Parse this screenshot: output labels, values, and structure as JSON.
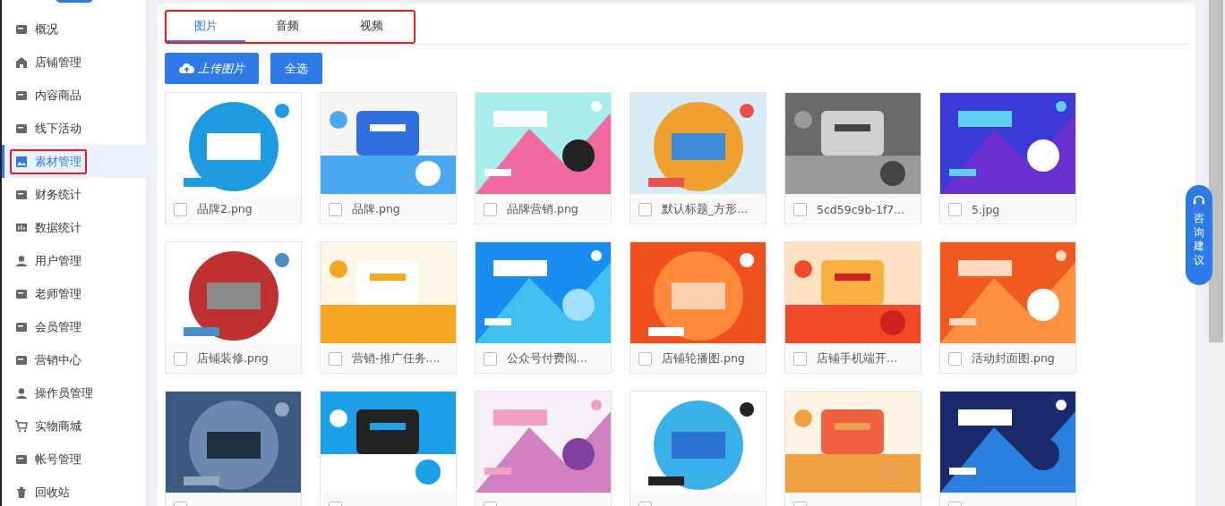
{
  "sidebar": {
    "items": [
      {
        "label": "概况",
        "selected": false,
        "highlighted": false
      },
      {
        "label": "店铺管理",
        "selected": false,
        "highlighted": false
      },
      {
        "label": "内容商品",
        "selected": false,
        "highlighted": false
      },
      {
        "label": "线下活动",
        "selected": false,
        "highlighted": false
      },
      {
        "label": "素材管理",
        "selected": true,
        "highlighted": true
      },
      {
        "label": "财务统计",
        "selected": false,
        "highlighted": false
      },
      {
        "label": "数据统计",
        "selected": false,
        "highlighted": false
      },
      {
        "label": "用户管理",
        "selected": false,
        "highlighted": false
      },
      {
        "label": "老师管理",
        "selected": false,
        "highlighted": false
      },
      {
        "label": "会员管理",
        "selected": false,
        "highlighted": false
      },
      {
        "label": "营销中心",
        "selected": false,
        "highlighted": false
      },
      {
        "label": "操作员管理",
        "selected": false,
        "highlighted": false
      },
      {
        "label": "实物商城",
        "selected": false,
        "highlighted": false
      },
      {
        "label": "帐号管理",
        "selected": false,
        "highlighted": false
      },
      {
        "label": "回收站",
        "selected": false,
        "highlighted": false
      }
    ]
  },
  "tabs": {
    "highlighted": true,
    "items": [
      {
        "label": "图片",
        "selected": true
      },
      {
        "label": "音频",
        "selected": false
      },
      {
        "label": "视频",
        "selected": false
      }
    ]
  },
  "buttons": [
    {
      "label": "上传图片",
      "kind": "upload"
    },
    {
      "label": "全选",
      "kind": "plain"
    }
  ],
  "images": [
    {
      "name": "品牌2.png",
      "checked": false,
      "kind": "picture"
    },
    {
      "name": "品牌.png",
      "checked": false,
      "kind": "picture"
    },
    {
      "name": "品牌营销.png",
      "checked": false,
      "kind": "picture"
    },
    {
      "name": "默认标题_方形...",
      "checked": false,
      "kind": "picture"
    },
    {
      "name": "5cd59c9b-1f7...",
      "checked": false,
      "kind": "picture"
    },
    {
      "name": "5.jpg",
      "checked": false,
      "kind": "picture"
    },
    {
      "name": "店铺装修.png",
      "checked": false,
      "kind": "picture"
    },
    {
      "name": "营销-推广任务....",
      "checked": false,
      "kind": "picture"
    },
    {
      "name": "公众号付费阅...",
      "checked": false,
      "kind": "picture"
    },
    {
      "name": "店铺轮播图.png",
      "checked": false,
      "kind": "picture"
    },
    {
      "name": "店铺手机端开...",
      "checked": false,
      "kind": "picture"
    },
    {
      "name": "活动封面图.png",
      "checked": false,
      "kind": "picture"
    },
    {
      "checked": false,
      "kind": "picture"
    },
    {
      "checked": false,
      "kind": "picture"
    },
    {
      "checked": false,
      "kind": "picture"
    },
    {
      "checked": false,
      "kind": "picture"
    },
    {
      "checked": false,
      "kind": "picture"
    },
    {
      "checked": false,
      "kind": "picture"
    }
  ],
  "float_button": {
    "label": "咨询建议"
  }
}
